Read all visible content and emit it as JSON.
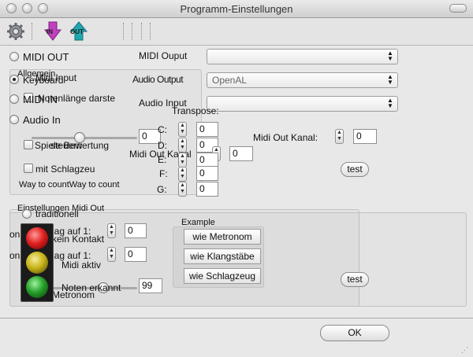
{
  "window": {
    "title": "Programm-Einstellungen"
  },
  "toolbar": {
    "gear_icon": "gear-icon",
    "in_label": "IN",
    "out_label": "OUT"
  },
  "left_radios": {
    "midi_out": "MIDI OUT",
    "allgemein": "Allgemein",
    "keyboard": "Keyboard",
    "midi_in": "MIDI IN",
    "audio_in": "Audio In"
  },
  "overlap_text": {
    "midi_input": "Midi Input",
    "notenlaenge": "Notenlänge darste",
    "t": "T",
    "spiele_bewertung": "Spiele Bewertung",
    "steuern": "steuern"
  },
  "general": {
    "slider_value": "0",
    "mit_schlagzeug": "mit Schlagzeu",
    "way_to_count": "Way to countWay to count"
  },
  "midi_out_panel": {
    "midi_ouput_label": "MIDI Ouput",
    "midi_ouput_value": "",
    "audio_output_label": "Audio Output",
    "audio_output_value": "OpenAL",
    "audio_input_label": "Audio Input",
    "audio_input_value": "",
    "transpose_label": "Transpose:",
    "notes": [
      {
        "label": "C:",
        "value": "0"
      },
      {
        "label": "D:",
        "value": "0"
      },
      {
        "label": "E:",
        "value": "0"
      },
      {
        "label": "F:",
        "value": "0"
      },
      {
        "label": "G:",
        "value": "0"
      }
    ],
    "extra_note_value": "0",
    "midi_out_kanal_label": "Midi Out Kanal:",
    "midi_out_kanal_value": "0",
    "midi_out_kanal2_label": "Midi Out Kanal",
    "midi_out_kanal2_value": "0",
    "test_label": "test"
  },
  "metronom_panel": {
    "title": "Metronom",
    "overlay_title": "Einstellungen Midi Out",
    "traditionell": "traditionell",
    "kein_kontakt": "kein Kontakt",
    "midi_aktiv": "Midi aktiv",
    "noten_erkannt": "Noten erkannt",
    "noten_erkannt_value": "99",
    "on_prefix": "on",
    "takt1_label": "lag auf 1:",
    "takt1_value": "0",
    "takt2_label": "lag auf 1:",
    "takt2_value": "0",
    "example_title": "Example",
    "example_buttons": [
      "wie Metronom",
      "wie Klangstäbe",
      "wie Schlagzeug"
    ],
    "test_label": "test"
  },
  "footer": {
    "ok_label": "OK"
  },
  "colors": {
    "lamp_red": "#e02020",
    "lamp_yellow": "#c8b418",
    "lamp_green": "#27a02a",
    "in_arrow": "#c040c0",
    "out_arrow": "#20a8b0"
  }
}
